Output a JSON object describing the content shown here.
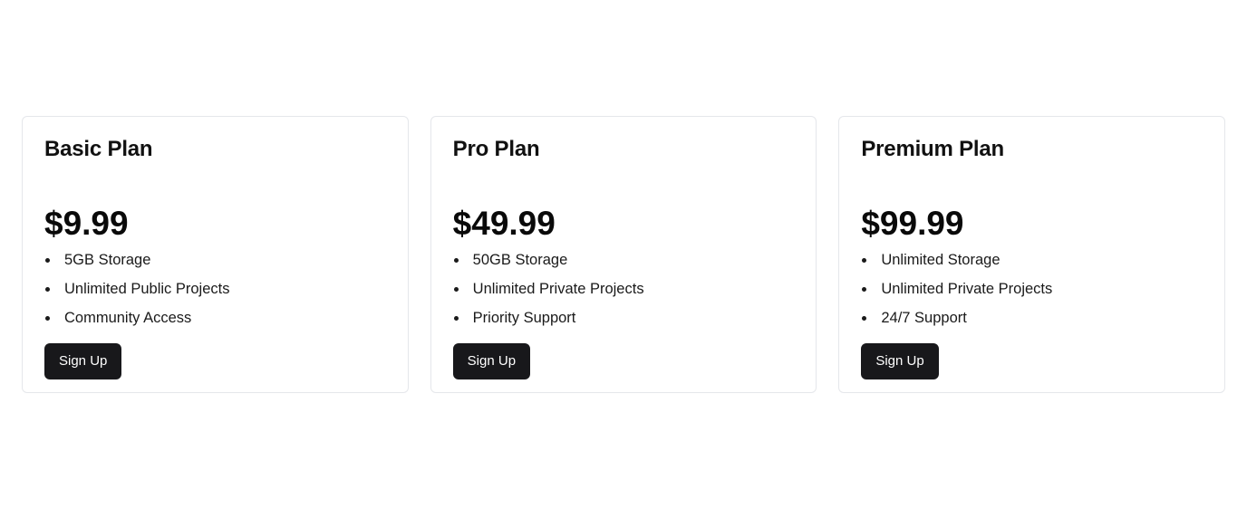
{
  "plans": [
    {
      "title": "Basic Plan",
      "price": "$9.99",
      "features": [
        "5GB Storage",
        "Unlimited Public Projects",
        "Community Access"
      ],
      "button_label": "Sign Up"
    },
    {
      "title": "Pro Plan",
      "price": "$49.99",
      "features": [
        "50GB Storage",
        "Unlimited Private Projects",
        "Priority Support"
      ],
      "button_label": "Sign Up"
    },
    {
      "title": "Premium Plan",
      "price": "$99.99",
      "features": [
        "Unlimited Storage",
        "Unlimited Private Projects",
        "24/7 Support"
      ],
      "button_label": "Sign Up"
    }
  ],
  "colors": {
    "button_background": "#18181b",
    "button_text": "#ffffff",
    "card_border": "#e5e7eb"
  }
}
